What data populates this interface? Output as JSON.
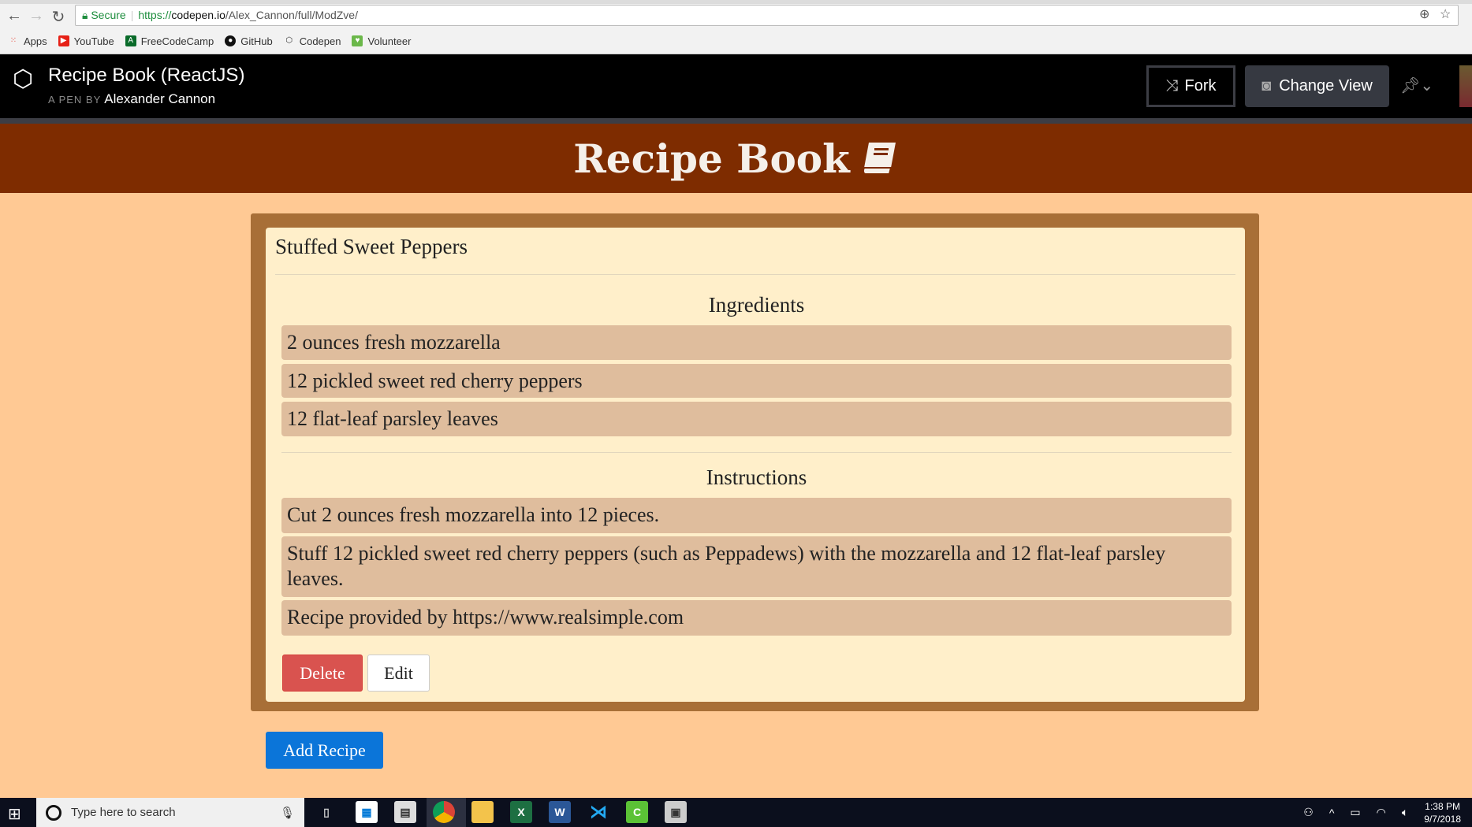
{
  "browser": {
    "secure_label": "Secure",
    "url_prefix": "https://",
    "url_host": "codepen.io",
    "url_path": "/Alex_Cannon/full/ModZve/",
    "bookmarks": [
      {
        "label": "Apps",
        "color": "#e84335"
      },
      {
        "label": "YouTube",
        "color": "#e62117"
      },
      {
        "label": "FreeCodeCamp",
        "color": "#0a6b2a"
      },
      {
        "label": "GitHub",
        "color": "#111111"
      },
      {
        "label": "Codepen",
        "color": "#333333"
      },
      {
        "label": "Volunteer",
        "color": "#6bb84a"
      }
    ]
  },
  "codepen": {
    "title": "Recipe Book (ReactJS)",
    "by_prefix": "A PEN BY",
    "author": "Alexander Cannon",
    "fork_label": "Fork",
    "change_view_label": "Change View"
  },
  "app": {
    "title": "Recipe Book",
    "recipe": {
      "name": "Stuffed Sweet Peppers",
      "ingredients_heading": "Ingredients",
      "ingredients": [
        "2 ounces fresh mozzarella",
        "12 pickled sweet red cherry peppers",
        "12 flat-leaf parsley leaves"
      ],
      "instructions_heading": "Instructions",
      "instructions": [
        "Cut 2 ounces fresh mozzarella into 12 pieces.",
        "Stuff 12 pickled sweet red cherry peppers (such as Peppadews) with the mozzarella and 12 flat-leaf parsley leaves.",
        "Recipe provided by https://www.realsimple.com"
      ],
      "delete_label": "Delete",
      "edit_label": "Edit"
    },
    "add_label": "Add Recipe"
  },
  "taskbar": {
    "search_placeholder": "Type here to search",
    "time": "1:38 PM",
    "date": "9/7/2018"
  }
}
